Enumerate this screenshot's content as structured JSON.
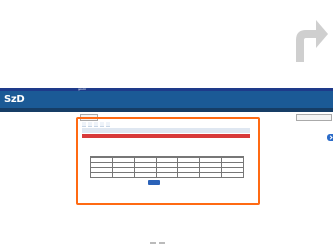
{
  "colors": {
    "nav_blue": "#1e3a8a",
    "brand_blue": "#1b5a96",
    "highlight_orange": "#ff6a13",
    "alert_red": "#d83a3a",
    "submit_blue": "#2b62b8"
  },
  "gov_bar": {
    "label": "gov.br",
    "nav": [
      "",
      "",
      "",
      "",
      ""
    ]
  },
  "brand": {
    "logo": "SzD",
    "subtitle": "",
    "top_links": [
      "",
      "",
      ""
    ]
  },
  "breadcrumb": {
    "text": "",
    "right": [
      "",
      "",
      ""
    ]
  },
  "tabs": [
    "",
    "",
    "",
    "",
    ""
  ],
  "section": {
    "title": ""
  },
  "table": {
    "headers": [
      "",
      "",
      "",
      "",
      "",
      "",
      ""
    ],
    "rows": [
      [
        "",
        "",
        "",
        "",
        "",
        "",
        ""
      ],
      [
        "",
        "",
        "",
        "",
        "",
        "",
        ""
      ],
      [
        "",
        "",
        "",
        "",
        "",
        "",
        ""
      ],
      [
        "",
        "",
        "",
        "",
        "",
        "",
        ""
      ]
    ]
  },
  "submit_label": "",
  "icons": {
    "big_arrow": "redo-arrow-icon",
    "side_tab": "chevron-right-icon"
  }
}
